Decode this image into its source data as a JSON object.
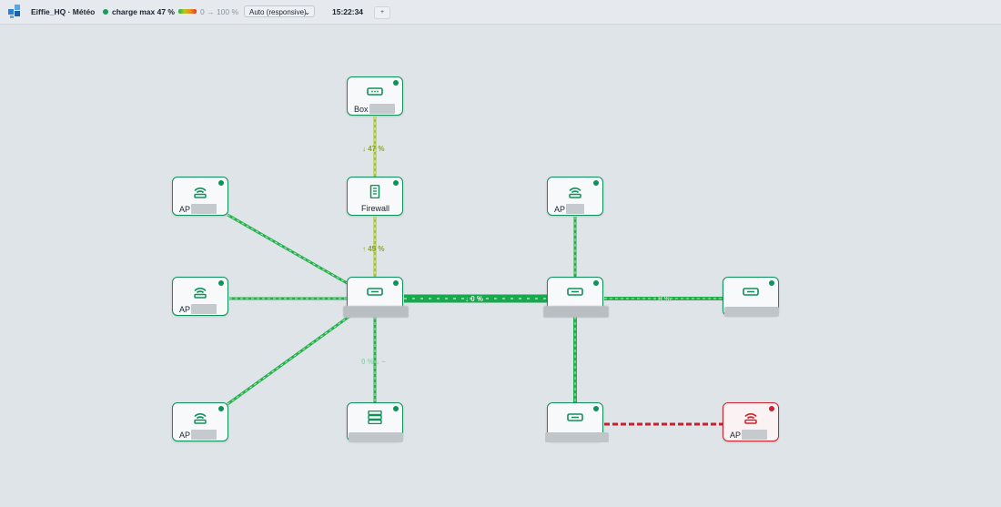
{
  "header": {
    "title": "Eiffie_HQ · Météo",
    "status_label": "charge max 47 %",
    "status_color": "#10a05a",
    "scale_label": "0 → 100 %",
    "mode_select": "Auto (responsive)",
    "clock": "15:22:34",
    "plus_button": "+"
  },
  "nodes": [
    {
      "id": "box",
      "label": "Box",
      "icon": "box-device-icon",
      "state": "up"
    },
    {
      "id": "firewall",
      "label": "Firewall",
      "icon": "firewall-icon",
      "state": "up"
    },
    {
      "id": "ap1",
      "label": "AP",
      "icon": "wifi-ap-icon",
      "state": "up"
    },
    {
      "id": "ap2",
      "label": "AP",
      "icon": "wifi-ap-icon",
      "state": "up"
    },
    {
      "id": "ap3",
      "label": "AP",
      "icon": "wifi-ap-icon",
      "state": "up"
    },
    {
      "id": "ap4",
      "label": "AP",
      "icon": "wifi-ap-icon",
      "state": "up"
    },
    {
      "id": "ap5",
      "label": "AP",
      "icon": "wifi-ap-icon",
      "state": "down"
    },
    {
      "id": "switch_core",
      "label": "",
      "icon": "switch-icon",
      "state": "up"
    },
    {
      "id": "switch_2",
      "label": "",
      "icon": "switch-icon",
      "state": "up"
    },
    {
      "id": "switch_3",
      "label": "",
      "icon": "switch-icon",
      "state": "up"
    },
    {
      "id": "switch_4",
      "label": "",
      "icon": "switch-icon",
      "state": "up"
    },
    {
      "id": "server",
      "label": "",
      "icon": "server-icon",
      "state": "up"
    }
  ],
  "links": {
    "box_firewall": "↓ 47 %",
    "firewall_core": "↑ 45 %",
    "core_switch2": "↓ 0 %",
    "switch2_switch3": "↓ 0 %",
    "core_server": "0 % ↓ ~"
  },
  "colors": {
    "link_ok": "#22b04a",
    "link_load": "#a6c52b",
    "link_down": "#d0202a",
    "node_ok": "#10915a",
    "node_down": "#d0202a"
  }
}
